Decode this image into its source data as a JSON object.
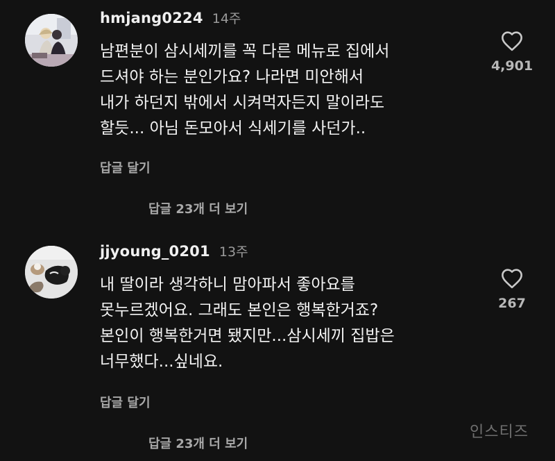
{
  "comments": [
    {
      "username": "hmjang0224",
      "time": "14주",
      "lines": [
        "남편분이 삼시세끼를 꼭 다른 메뉴로 집에서",
        "드셔야 하는 분인가요? 나라면 미안해서",
        "내가 하던지 밖에서 시켜먹자든지 말이라도",
        "할듯... 아님 돈모아서 식세기를 사던가.."
      ],
      "like_icon": "heart-outline-icon",
      "likes": "4,901",
      "reply_label": "답글 달기",
      "view_replies_label": "답글 23개 더 보기"
    },
    {
      "username": "jjyoung_0201",
      "time": "13주",
      "lines": [
        "내 딸이라 생각하니 맘아파서 좋아요를",
        "못누르겠어요. 그래도 본인은 행복한거죠?",
        "본인이 행복한거면 됐지만...삼시세끼 집밥은",
        "너무했다...싶네요."
      ],
      "like_icon": "heart-outline-icon",
      "likes": "267",
      "reply_label": "답글 달기",
      "view_replies_label": "답글 23개 더 보기"
    }
  ],
  "watermark": "인스티즈",
  "colors": {
    "background": "#121212",
    "text": "#f3f3f3",
    "secondary": "#a9a9a9",
    "timestamp": "#9b9b9b"
  }
}
